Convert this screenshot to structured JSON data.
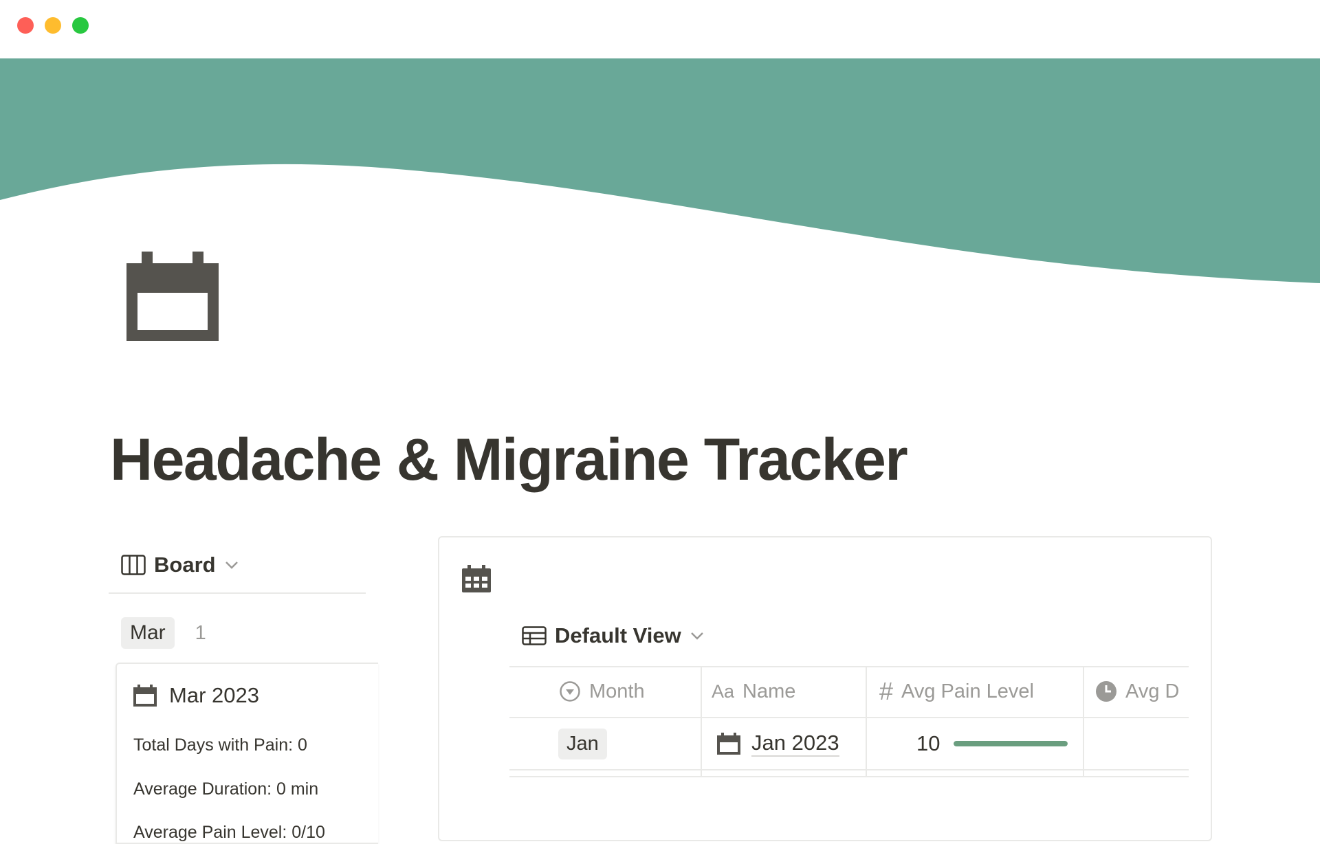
{
  "colors": {
    "cover": "#69a898",
    "text": "#37352f",
    "muted": "#9b9a97",
    "bar": "#6a9e7f",
    "tag_bg": "#eeeeed"
  },
  "page": {
    "title": "Headache & Migraine Tracker",
    "icon": "calendar-icon"
  },
  "board": {
    "view_label": "Board",
    "group": {
      "label": "Mar",
      "count": "1"
    },
    "card": {
      "title": "Mar 2023",
      "props": [
        "Total Days with Pain: 0",
        "Average Duration: 0 min",
        "Average Pain Level: 0/10"
      ]
    }
  },
  "database": {
    "icon": "calendar-grid-icon",
    "view_label": "Default View",
    "columns": [
      {
        "label": "Month",
        "icon": "select-icon",
        "icon_glyph": ""
      },
      {
        "label": "Name",
        "icon": "title-icon",
        "icon_glyph": "Aa"
      },
      {
        "label": "Avg Pain Level",
        "icon": "number-icon",
        "icon_glyph": "#"
      },
      {
        "label": "Avg D",
        "icon": "clock-icon",
        "icon_glyph": ""
      }
    ],
    "rows": [
      {
        "month": "Jan",
        "name": "Jan 2023",
        "avg_pain": "10",
        "pain_fraction": 1.0
      }
    ]
  }
}
